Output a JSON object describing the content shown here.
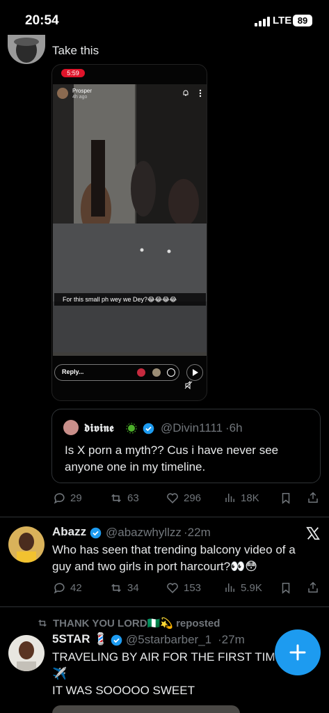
{
  "status_bar": {
    "time": "20:54",
    "network": "LTE",
    "battery": "89"
  },
  "tweet1": {
    "text": "Take this",
    "story": {
      "time": "5:59",
      "user": "Prosper",
      "age": "4h ago",
      "caption": "For this small ph wey we Dey?😂😂😂😂",
      "reply_placeholder": "Reply..."
    },
    "quote": {
      "name": "𝖉𝖎𝖛𝖎𝖓𝖊",
      "handle": "@Divin1111",
      "time": "6h",
      "text_line1": "Is X porn a myth?? Cus i have never see",
      "text_line2": "anyone one in my timeline."
    },
    "stats": {
      "replies": "29",
      "reposts": "63",
      "likes": "296",
      "views": "18K"
    }
  },
  "tweet2": {
    "name": "Abazz",
    "handle": "@abazwhyllzz",
    "time": "22m",
    "text_line1": "Who has seen that trending balcony video of a",
    "text_line2": "guy and two girls in port harcourt?👀😳",
    "stats": {
      "replies": "42",
      "reposts": "34",
      "likes": "153",
      "views": "5.9K"
    }
  },
  "tweet3": {
    "reposted_by": "THANK YOU LORD🇳🇬💫 reposted",
    "name": "5STAR 💈",
    "handle": "@5starbarber_1",
    "time": "27m",
    "text_line1": "TRAVELING BY AIR FOR THE FIRST TIM",
    "text_line2": "✈️",
    "text_line3": "IT WAS SOOOOO SWEET"
  },
  "colors": {
    "accent": "#1d9bf0",
    "muted": "#71767b",
    "text": "#e7e9ea",
    "divider": "#2f3336"
  }
}
